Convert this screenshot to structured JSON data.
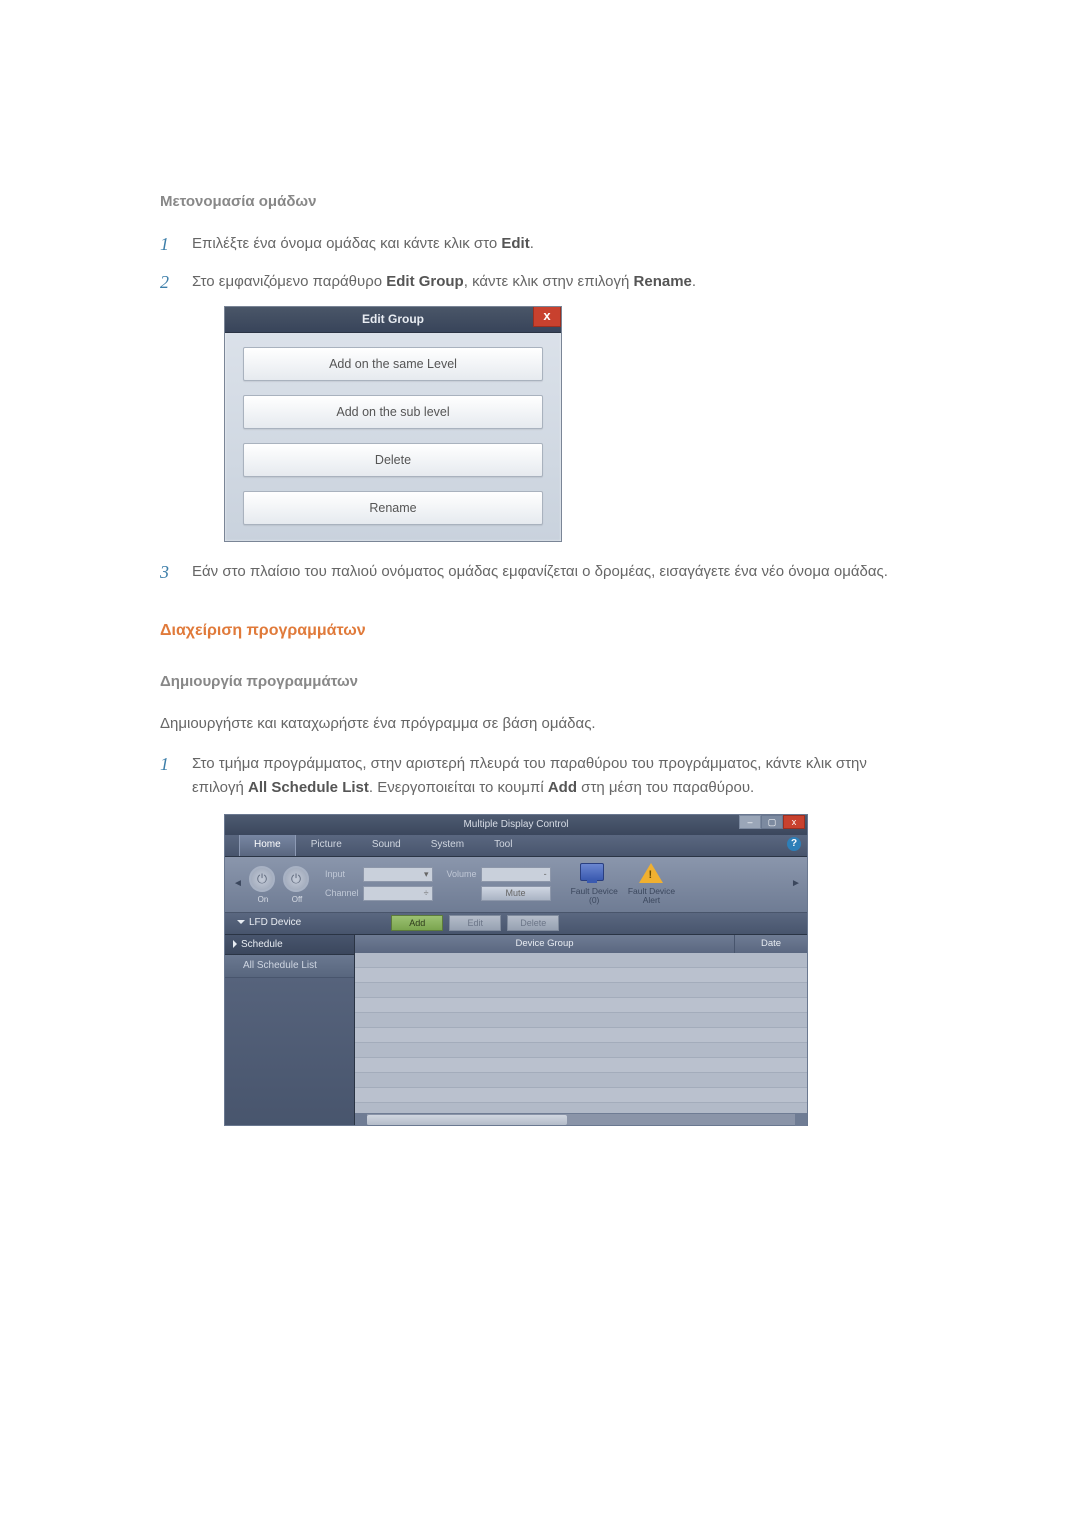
{
  "rename": {
    "title": "Μετονομασία ομάδων",
    "step1_pre": "Επιλέξτε ένα όνομα ομάδας και κάντε κλικ στο ",
    "step1_bold": "Edit",
    "step1_post": ".",
    "step2_pre": "Στο εμφανιζόμενο παράθυρο ",
    "step2_b1": "Edit Group",
    "step2_mid": ", κάντε κλικ στην επιλογή ",
    "step2_b2": "Rename",
    "step2_post": ".",
    "step3": "Εάν στο πλαίσιο του παλιού ονόματος ομάδας εμφανίζεται ο δρομέας, εισαγάγετε ένα νέο όνομα ομάδας."
  },
  "editGroup": {
    "title": "Edit Group",
    "close": "x",
    "btn1": "Add on the same Level",
    "btn2": "Add on the sub level",
    "btn3": "Delete",
    "btn4": "Rename"
  },
  "schedules": {
    "heading": "Διαχείριση προγραμμάτων",
    "subheading": "Δημιουργία προγραμμάτων",
    "intro": "Δημιουργήστε και καταχωρήστε ένα πρόγραμμα σε βάση ομάδας.",
    "step1_pre": "Στο τμήμα προγράμματος, στην αριστερή πλευρά του παραθύρου του προγράμματος, κάντε κλικ στην επιλογή ",
    "step1_b1": "All Schedule List",
    "step1_mid": ". Ενεργοποιείται το κουμπί ",
    "step1_b2": "Add",
    "step1_post": " στη μέση του παραθύρου."
  },
  "mdc": {
    "title": "Multiple Display Control",
    "help": "?",
    "tabs": {
      "home": "Home",
      "picture": "Picture",
      "sound": "Sound",
      "system": "System",
      "tool": "Tool"
    },
    "power": {
      "on": "On",
      "off": "Off"
    },
    "fields": {
      "input": "Input",
      "channel": "Channel",
      "volume": "Volume",
      "mute": "Mute",
      "dash": "-",
      "caret": "▾",
      "stepper": "÷"
    },
    "fault": {
      "device": "Fault Device\n(0)",
      "alert": "Fault Device\nAlert"
    },
    "tree": {
      "lfd": "LFD Device",
      "schedule": "Schedule",
      "all": "All Schedule List"
    },
    "actions": {
      "add": "Add",
      "edit": "Edit",
      "delete": "Delete"
    },
    "table": {
      "group": "Device Group",
      "date": "Date"
    }
  }
}
